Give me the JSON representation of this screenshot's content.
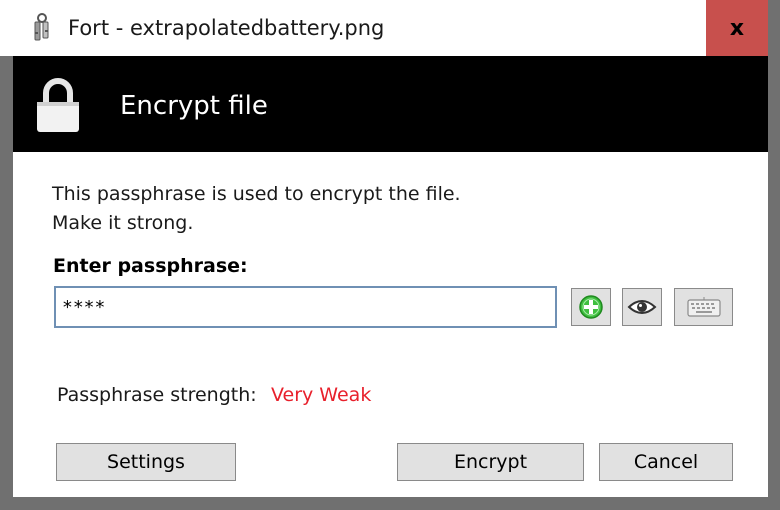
{
  "window": {
    "title": "Fort - extrapolatedbattery.png",
    "close_glyph": "x",
    "app_icon": "key-ring-icon"
  },
  "header": {
    "title": "Encrypt file",
    "icon": "lock-icon"
  },
  "content": {
    "description_line1": "This passphrase is used to encrypt the file.",
    "description_line2": "Make it strong.",
    "passphrase_label": "Enter passphrase:",
    "passphrase_value": "****",
    "tool_buttons": [
      {
        "icon": "add-icon",
        "color": "#3fbf3f"
      },
      {
        "icon": "eye-icon"
      },
      {
        "icon": "keyboard-icon"
      }
    ],
    "strength_label": "Passphrase strength:",
    "strength_value": "Very Weak",
    "strength_color": "#e8202b"
  },
  "buttons": {
    "settings": "Settings",
    "encrypt": "Encrypt",
    "cancel": "Cancel"
  },
  "colors": {
    "close_button": "#c8504d",
    "header_bg": "#000000",
    "input_border": "#6f90b4",
    "frame": "#707070"
  }
}
